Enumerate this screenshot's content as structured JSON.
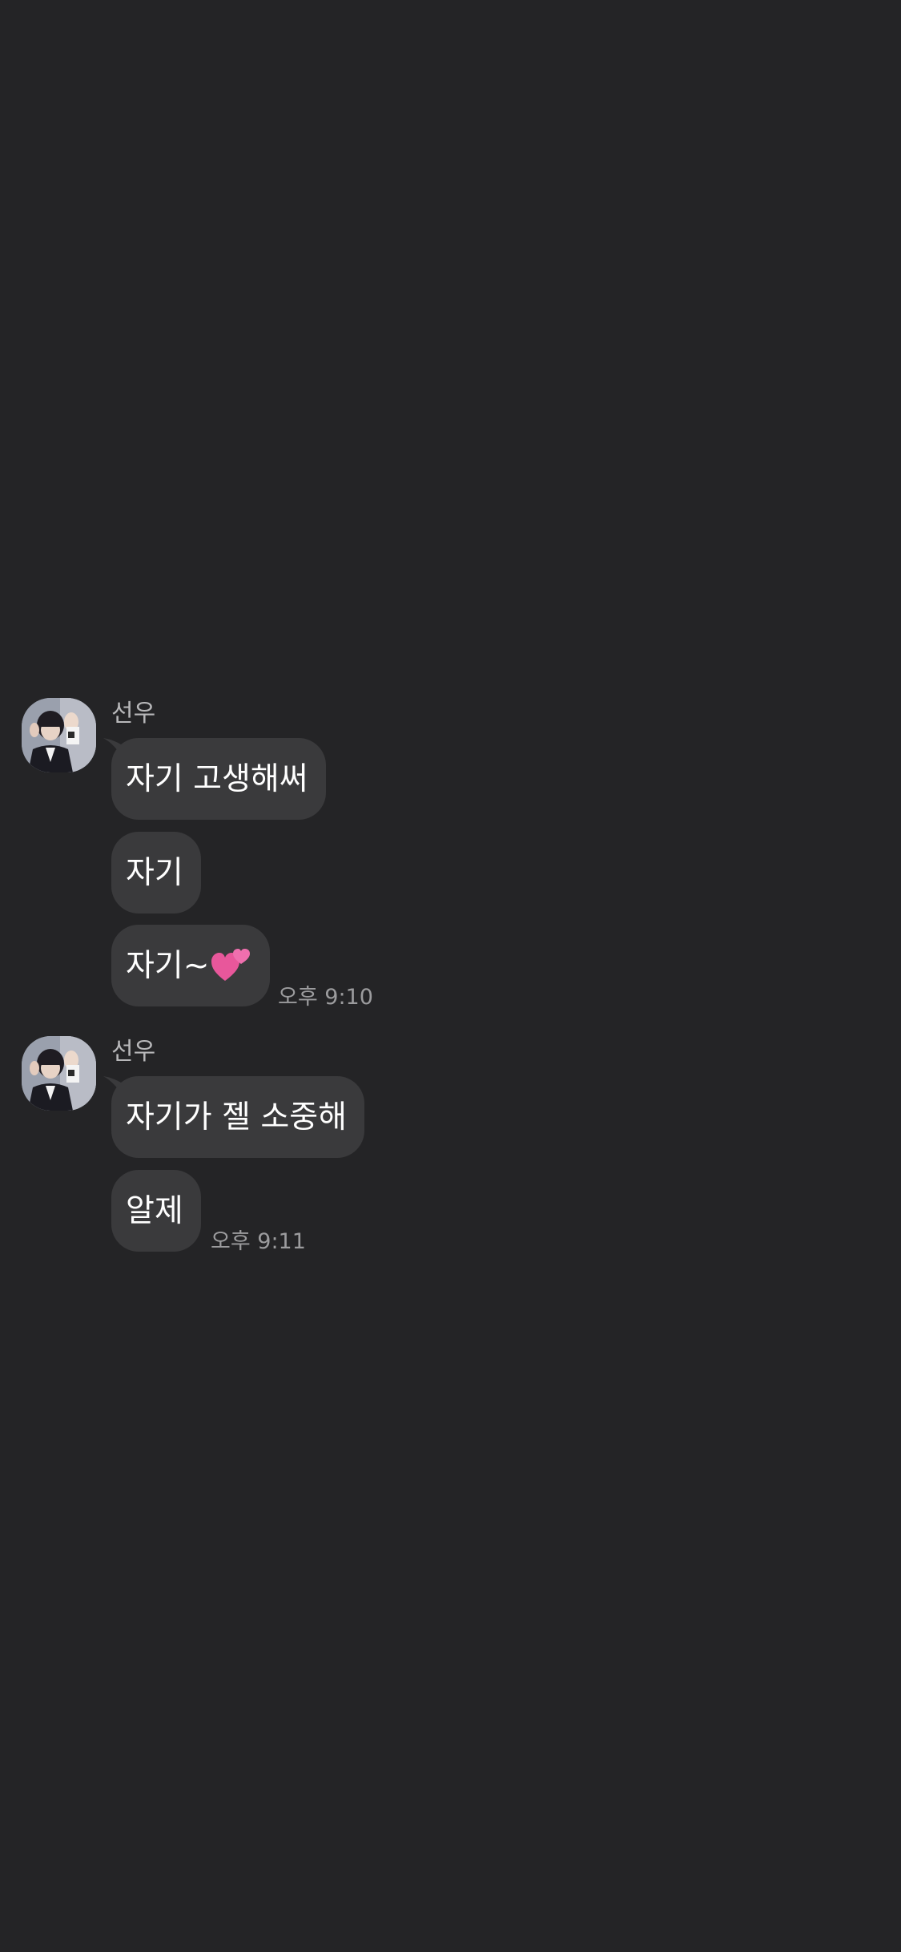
{
  "colors": {
    "background": "#242426",
    "bubble": "#3a3a3c",
    "bubble_text": "#ffffff",
    "sender_name": "#b8b8ba",
    "timestamp": "#9c9c9e"
  },
  "groups": [
    {
      "sender": "선우",
      "avatar_icon": "profile-photo",
      "messages": [
        {
          "text": "자기 고생해써"
        },
        {
          "text": "자기"
        },
        {
          "text": "자기~",
          "emoji_icon": "two-hearts-icon"
        }
      ],
      "timestamp": "오후 9:10"
    },
    {
      "sender": "선우",
      "avatar_icon": "profile-photo",
      "messages": [
        {
          "text": "자기가 젤 소중해"
        },
        {
          "text": "알제"
        }
      ],
      "timestamp": "오후 9:11"
    }
  ]
}
